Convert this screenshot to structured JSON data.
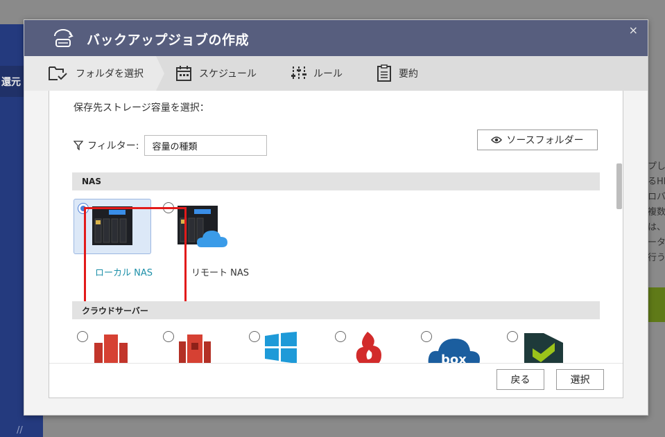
{
  "background": {
    "left_tab": "還元",
    "right_lines": [
      "プし",
      "るHI",
      "ロバ",
      "複数",
      "は、",
      "ータ",
      "行う"
    ]
  },
  "dialog": {
    "title": "バックアップジョブの作成",
    "close": "×",
    "steps": [
      {
        "label": "フォルダを選択",
        "icon": "folder-check-icon"
      },
      {
        "label": "スケジュール",
        "icon": "calendar-icon"
      },
      {
        "label": "ルール",
        "icon": "sliders-icon"
      },
      {
        "label": "要約",
        "icon": "clipboard-icon"
      }
    ],
    "heading": "保存先ストレージ容量を選択：",
    "filter": {
      "label": "フィルター:",
      "value": "容量の種類"
    },
    "source_button": "ソースフォルダー",
    "nas_section": "NAS",
    "nas_options": [
      {
        "label": "ローカル NAS",
        "selected": true
      },
      {
        "label": "リモート NAS",
        "selected": false
      }
    ],
    "cloud_section": "クラウドサーバー",
    "cloud_options": [
      "amazon-glacier-icon",
      "amazon-s3-icon",
      "azure-windows-icon",
      "backblaze-icon",
      "box-icon",
      "alibaba-oss-icon"
    ],
    "back_button": "戻る",
    "select_button": "選択"
  },
  "colors": {
    "titlebar": "#575e7e",
    "selected_label": "#1c8fa8",
    "highlight": "#e21a1a",
    "radio": "#4a7ed8"
  }
}
